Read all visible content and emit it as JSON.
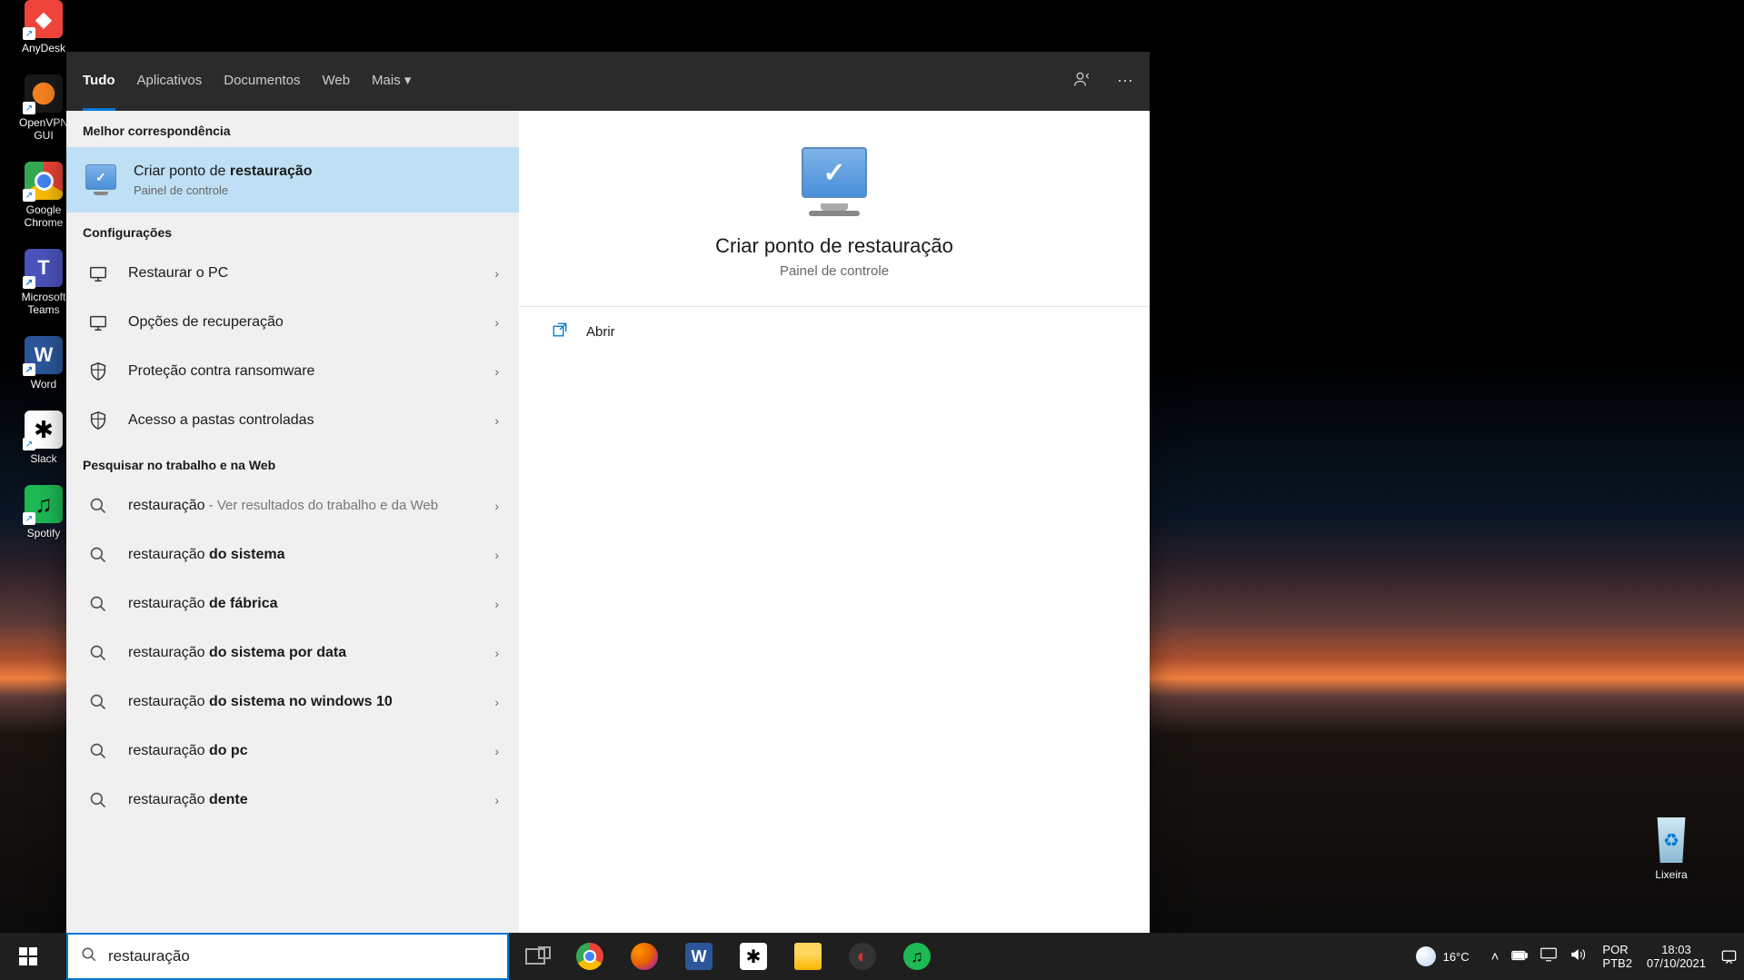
{
  "desktop": {
    "icons_left": [
      {
        "name": "anydesk",
        "label": "AnyDesk"
      },
      {
        "name": "openvpn",
        "label": "OpenVPN GUI"
      },
      {
        "name": "chrome",
        "label": "Google Chrome"
      },
      {
        "name": "teams",
        "label": "Microsoft Teams"
      },
      {
        "name": "word",
        "label": "Word"
      },
      {
        "name": "slack",
        "label": "Slack"
      },
      {
        "name": "spotify",
        "label": "Spotify"
      }
    ],
    "recycle_bin_label": "Lixeira"
  },
  "search_panel": {
    "tabs": [
      "Tudo",
      "Aplicativos",
      "Documentos",
      "Web",
      "Mais"
    ],
    "active_tab_index": 0,
    "sections": {
      "best_match_title": "Melhor correspondência",
      "best_match": {
        "title_pre": "Criar ponto de ",
        "title_hl": "restauração",
        "subtitle": "Painel de controle"
      },
      "settings_title": "Configurações",
      "settings": [
        {
          "icon": "restore",
          "label": "Restaurar o PC"
        },
        {
          "icon": "recovery",
          "label": "Opções de recuperação"
        },
        {
          "icon": "shield",
          "label": "Proteção contra ransomware"
        },
        {
          "icon": "shield",
          "label": "Acesso a pastas controladas"
        }
      ],
      "web_title": "Pesquisar no trabalho e na Web",
      "web": [
        {
          "term": "restauração",
          "suffix": " - Ver resultados do trabalho e da Web",
          "bold": ""
        },
        {
          "term": "restauração ",
          "suffix": "",
          "bold": "do sistema"
        },
        {
          "term": "restauração ",
          "suffix": "",
          "bold": "de fábrica"
        },
        {
          "term": "restauração ",
          "suffix": "",
          "bold": "do sistema por data"
        },
        {
          "term": "restauração ",
          "suffix": "",
          "bold": "do sistema no windows 10"
        },
        {
          "term": "restauração ",
          "suffix": "",
          "bold": "do pc"
        },
        {
          "term": "restauração ",
          "suffix": "",
          "bold": "dente"
        }
      ]
    },
    "preview": {
      "title": "Criar ponto de restauração",
      "subtitle": "Painel de controle",
      "actions": [
        {
          "icon": "open",
          "label": "Abrir"
        }
      ]
    }
  },
  "search_box": {
    "value": "restauração"
  },
  "taskbar": {
    "apps": [
      {
        "name": "taskview"
      },
      {
        "name": "chrome"
      },
      {
        "name": "firefox"
      },
      {
        "name": "word"
      },
      {
        "name": "slack"
      },
      {
        "name": "explorer"
      },
      {
        "name": "photoscape"
      },
      {
        "name": "spotify"
      }
    ]
  },
  "systray": {
    "weather": {
      "temp": "16°C"
    },
    "tray_icons": [
      "chevron-up",
      "battery",
      "monitor",
      "volume"
    ],
    "lang": {
      "line1": "POR",
      "line2": "PTB2"
    },
    "clock": {
      "time": "18:03",
      "date": "07/10/2021"
    }
  }
}
